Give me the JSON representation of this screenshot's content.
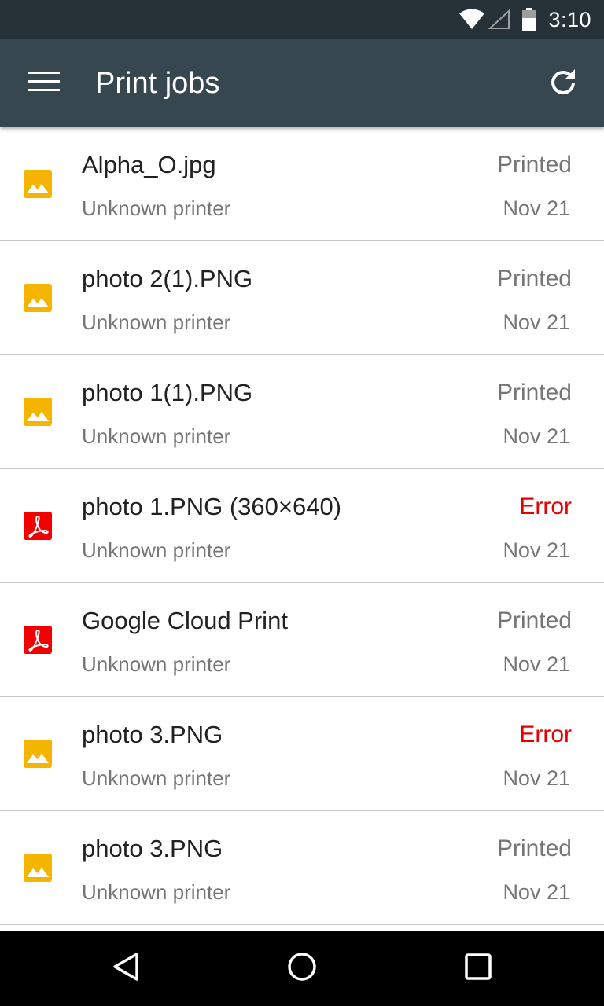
{
  "status_bar": {
    "time": "3:10",
    "icons": [
      "wifi-icon",
      "cell-signal-icon",
      "battery-icon"
    ]
  },
  "app_bar": {
    "title": "Print jobs",
    "menu_icon": "hamburger-menu-icon",
    "refresh_icon": "refresh-icon"
  },
  "jobs": [
    {
      "name": "Alpha_O.jpg",
      "printer": "Unknown printer",
      "status": "Printed",
      "date": "Nov 21",
      "icon": "image-file-icon"
    },
    {
      "name": "photo 2(1).PNG",
      "printer": "Unknown printer",
      "status": "Printed",
      "date": "Nov 21",
      "icon": "image-file-icon"
    },
    {
      "name": "photo 1(1).PNG",
      "printer": "Unknown printer",
      "status": "Printed",
      "date": "Nov 21",
      "icon": "image-file-icon"
    },
    {
      "name": "photo 1.PNG (360×640)",
      "printer": "Unknown printer",
      "status": "Error",
      "date": "Nov 21",
      "icon": "pdf-file-icon"
    },
    {
      "name": "Google Cloud Print",
      "printer": "Unknown printer",
      "status": "Printed",
      "date": "Nov 21",
      "icon": "pdf-file-icon"
    },
    {
      "name": "photo 3.PNG",
      "printer": "Unknown printer",
      "status": "Error",
      "date": "Nov 21",
      "icon": "image-file-icon"
    },
    {
      "name": "photo 3.PNG",
      "printer": "Unknown printer",
      "status": "Printed",
      "date": "Nov 21",
      "icon": "image-file-icon"
    }
  ],
  "nav_bar": {
    "icons": [
      "back-icon",
      "home-icon",
      "recents-icon"
    ]
  },
  "colors": {
    "status_bar": "#263238",
    "app_bar": "#37474f",
    "image_icon": "#f4b400",
    "pdf_icon": "#f20000",
    "error_text": "#e50000",
    "secondary_text": "#757575"
  }
}
